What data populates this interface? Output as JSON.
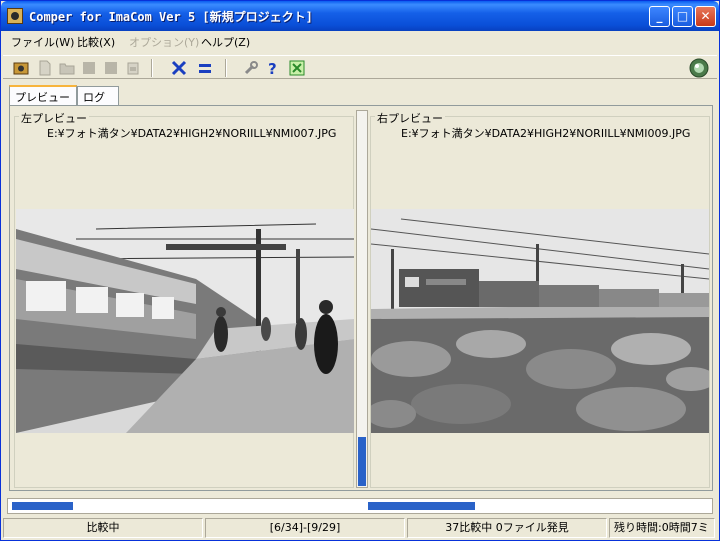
{
  "window": {
    "title": "Comper for ImaCom Ver 5 [新規プロジェクト]"
  },
  "titlebar_buttons": {
    "minimize": "_",
    "maximize": "□",
    "close": "✕"
  },
  "menu": [
    {
      "label": "ファイル(W)",
      "enabled": true
    },
    {
      "label": "比較(X)",
      "enabled": true
    },
    {
      "label": "オプション(Y)",
      "enabled": false
    },
    {
      "label": "ヘルプ(Z)",
      "enabled": true
    }
  ],
  "toolbar": {
    "tools": [
      {
        "icon": "project-icon"
      },
      {
        "icon": "new-file-icon"
      },
      {
        "icon": "open-folder-icon"
      },
      {
        "icon": "save-icon"
      },
      {
        "icon": "save-all-icon"
      },
      {
        "icon": "print-icon"
      },
      {
        "icon": "cross-compare-icon"
      },
      {
        "icon": "equal-icon"
      },
      {
        "icon": "wrench-icon"
      },
      {
        "icon": "help-icon"
      },
      {
        "icon": "export-icon"
      }
    ],
    "right_icon": "globe-icon"
  },
  "tabs": [
    {
      "label": "プレビュー",
      "active": true
    },
    {
      "label": "ログ",
      "active": false
    }
  ],
  "left_preview": {
    "label": "左プレビュー",
    "path": "E:¥フォト満タン¥DATA2¥HIGH2¥NORIILL¥NMI007.JPG",
    "image_alt": "station-platform-photo"
  },
  "right_preview": {
    "label": "右プレビュー",
    "path": "E:¥フォト満タン¥DATA2¥HIGH2¥NORIILL¥NMI009.JPG",
    "image_alt": "train-lotus-field-photo"
  },
  "splitter": {
    "level_fraction": 0.13
  },
  "progress": {
    "left_fraction": 0.09,
    "right_fraction": 0.3
  },
  "status": {
    "state": "比較中",
    "counter": "[6/34]-[9/29]",
    "summary": "37比較中 0ファイル発見",
    "remaining": "残り時間:0時間7ミ"
  },
  "colors": {
    "accent": "#2a62c8",
    "titlebar": "#0a4fd8",
    "tab_highlight": "#f7b43c"
  }
}
